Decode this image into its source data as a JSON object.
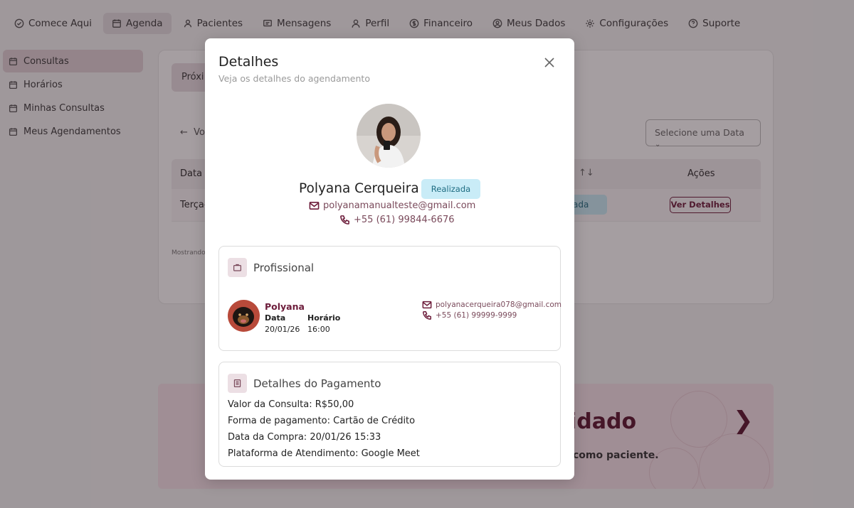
{
  "topnav": {
    "items": [
      {
        "label": "Comece Aqui",
        "icon": "check-circle-icon"
      },
      {
        "label": "Agenda",
        "icon": "calendar-icon",
        "active": true
      },
      {
        "label": "Pacientes",
        "icon": "user-icon"
      },
      {
        "label": "Mensagens",
        "icon": "message-icon"
      },
      {
        "label": "Perfil",
        "icon": "user-icon"
      },
      {
        "label": "Financeiro",
        "icon": "dollar-icon"
      },
      {
        "label": "Meus Dados",
        "icon": "user-circle-icon"
      },
      {
        "label": "Configurações",
        "icon": "gear-icon"
      },
      {
        "label": "Suporte",
        "icon": "help-icon"
      }
    ]
  },
  "sidebar": {
    "items": [
      {
        "label": "Consultas",
        "active": true
      },
      {
        "label": "Horários"
      },
      {
        "label": "Minhas Consultas"
      },
      {
        "label": "Meus Agendamentos"
      }
    ]
  },
  "background": {
    "tab_label": "Próxi",
    "back_label": "Vo",
    "date_select": "Selecione uma Data",
    "table": {
      "col_data": "Data",
      "col_sort": "↑↓",
      "col_acoes": "Ações",
      "row_date": "Terça-",
      "row_status": "ada",
      "row_button": "Ver Detalhes"
    },
    "mostrando": "Mostrando",
    "promo_title": "idado",
    "promo_sub": "como paciente.",
    "promo_arrow": "❯"
  },
  "modal": {
    "title": "Detalhes",
    "subtitle": "Veja os detalhes do agendamento",
    "patient": {
      "name": "Polyana Cerqueira",
      "status": "Realizada",
      "email": "polyanamanualteste@gmail.com",
      "phone": "+55 (61) 99844-6676"
    },
    "profissional": {
      "section_title": "Profissional",
      "name": "Polyana",
      "label_data": "Data",
      "label_horario": "Horário",
      "data": "20/01/26",
      "horario": "16:00",
      "email": "polyanacerqueira078@gmail.com",
      "phone": "+55 (61) 99999-9999"
    },
    "pagamento": {
      "section_title": "Detalhes do Pagamento",
      "valor_label": "Valor da Consulta:",
      "valor": "R$50,00",
      "forma_label": "Forma de pagamento:",
      "forma": "Cartão de Crédito",
      "data_label": "Data da Compra:",
      "data": "20/01/26 15:33",
      "plataforma_label": "Plataforma de Atendimento:",
      "plataforma": "Google Meet"
    }
  },
  "colors": {
    "accent": "#6d1d3b",
    "badge_bg": "#c9ecf7",
    "badge_text": "#1f6d82"
  }
}
